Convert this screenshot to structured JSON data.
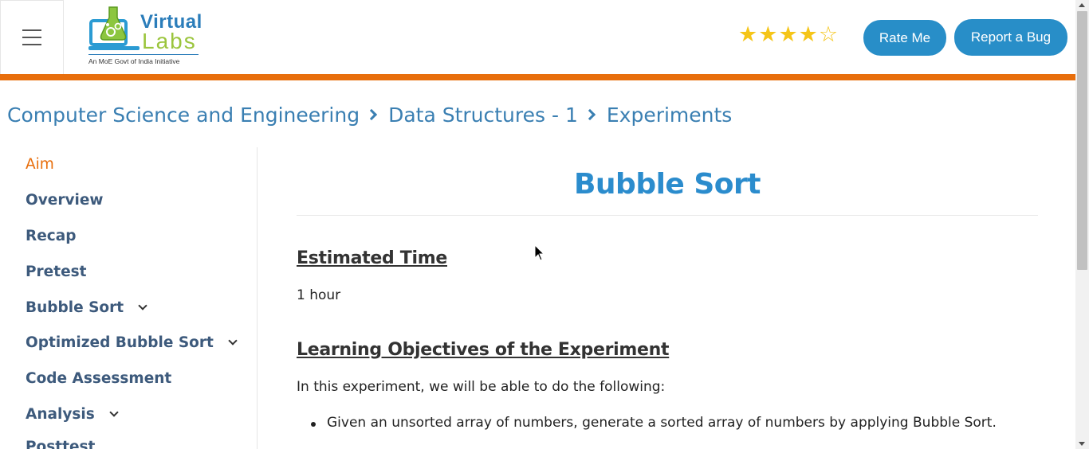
{
  "header": {
    "menu_icon": "hamburger-menu-icon",
    "logo": {
      "word1": "Virtual",
      "word2": "Labs",
      "tagline": "An MoE Govt of India Initiative",
      "colors": {
        "virtual": "#2b7dba",
        "labs": "#9bc53d"
      }
    },
    "rating": {
      "value": 4,
      "max": 5,
      "color": "#f5c518"
    },
    "rate_button": "Rate Me",
    "bug_button": "Report a Bug",
    "accent_color": "#e86e0c",
    "button_color": "#288ec8"
  },
  "breadcrumb": {
    "items": [
      "Computer Science and Engineering",
      "Data Structures - 1",
      "Experiments"
    ]
  },
  "sidebar": {
    "items": [
      {
        "label": "Aim",
        "active": true,
        "expandable": false
      },
      {
        "label": "Overview",
        "active": false,
        "expandable": false
      },
      {
        "label": "Recap",
        "active": false,
        "expandable": false
      },
      {
        "label": "Pretest",
        "active": false,
        "expandable": false
      },
      {
        "label": "Bubble Sort",
        "active": false,
        "expandable": true
      },
      {
        "label": "Optimized Bubble Sort",
        "active": false,
        "expandable": true
      },
      {
        "label": "Code Assessment",
        "active": false,
        "expandable": false
      },
      {
        "label": "Analysis",
        "active": false,
        "expandable": true
      },
      {
        "label": "Posttest",
        "active": false,
        "expandable": false
      }
    ]
  },
  "main": {
    "title": "Bubble Sort",
    "section1_heading": "Estimated Time",
    "section1_text": "1 hour",
    "section2_heading": "Learning Objectives of the Experiment",
    "section2_intro": "In this experiment, we will be able to do the following:",
    "objectives": [
      "Given an unsorted array of numbers, generate a sorted array of numbers by applying Bubble Sort."
    ]
  }
}
